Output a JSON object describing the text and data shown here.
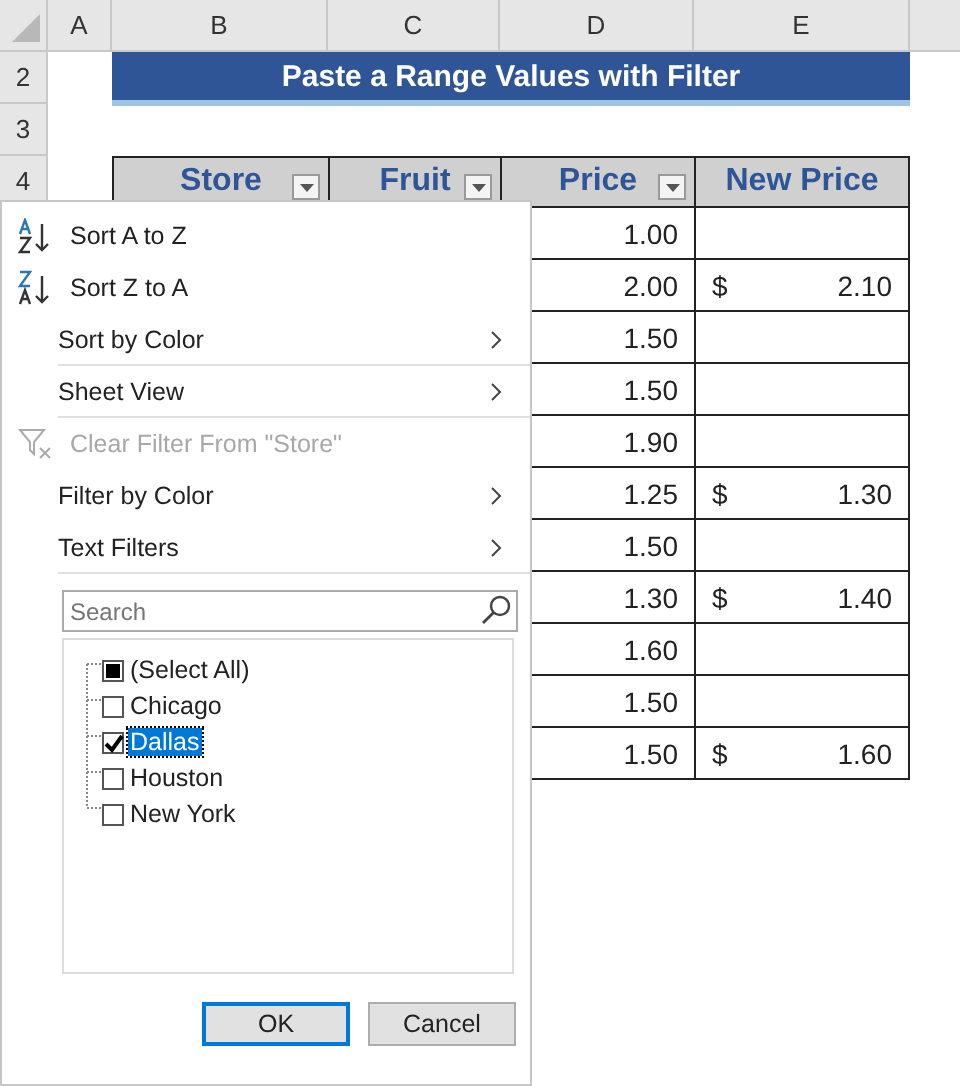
{
  "columns": [
    "A",
    "B",
    "C",
    "D",
    "E"
  ],
  "row_numbers": [
    "2",
    "3",
    "4"
  ],
  "title": "Paste a Range Values with Filter",
  "headers": [
    {
      "label": "Store",
      "filter": true
    },
    {
      "label": "Fruit",
      "filter": true
    },
    {
      "label": "Price",
      "filter": true
    },
    {
      "label": "New Price",
      "filter": false
    }
  ],
  "rows": [
    {
      "price": "1.00"
    },
    {
      "price": "2.00",
      "currency": "$",
      "new_price": "2.10"
    },
    {
      "price": "1.50"
    },
    {
      "price": "1.50"
    },
    {
      "price": "1.90"
    },
    {
      "price": "1.25",
      "currency": "$",
      "new_price": "1.30"
    },
    {
      "price": "1.50"
    },
    {
      "price": "1.30",
      "currency": "$",
      "new_price": "1.40"
    },
    {
      "price": "1.60"
    },
    {
      "price": "1.50"
    },
    {
      "price": "1.50",
      "currency": "$",
      "new_price": "1.60"
    }
  ],
  "filter_menu": {
    "items": [
      {
        "kind": "sort-asc",
        "label": "Sort A to Z",
        "disabled": false,
        "separator_after": false
      },
      {
        "kind": "sort-desc",
        "label": "Sort Z to A",
        "disabled": false,
        "separator_after": false
      },
      {
        "kind": "submenu",
        "label": "Sort by Color",
        "disabled": false,
        "separator_after": true
      },
      {
        "kind": "submenu",
        "label": "Sheet View",
        "disabled": false,
        "separator_after": true
      },
      {
        "kind": "clear",
        "label": "Clear Filter From \"Store\"",
        "disabled": true,
        "separator_after": false
      },
      {
        "kind": "submenu",
        "label": "Filter by Color",
        "disabled": false,
        "separator_after": false
      },
      {
        "kind": "submenu",
        "label": "Text Filters",
        "disabled": false,
        "separator_after": true
      }
    ],
    "search": {
      "placeholder": "Search"
    },
    "values": [
      {
        "label": "(Select All)",
        "checked": false,
        "partial": true,
        "selected": false
      },
      {
        "label": "Chicago",
        "checked": false,
        "selected": false
      },
      {
        "label": "Dallas",
        "checked": true,
        "selected": true
      },
      {
        "label": "Houston",
        "checked": false,
        "selected": false
      },
      {
        "label": "New York",
        "checked": false,
        "selected": false
      }
    ],
    "buttons": [
      {
        "label": "OK",
        "default": true
      },
      {
        "label": "Cancel",
        "default": false
      }
    ]
  }
}
